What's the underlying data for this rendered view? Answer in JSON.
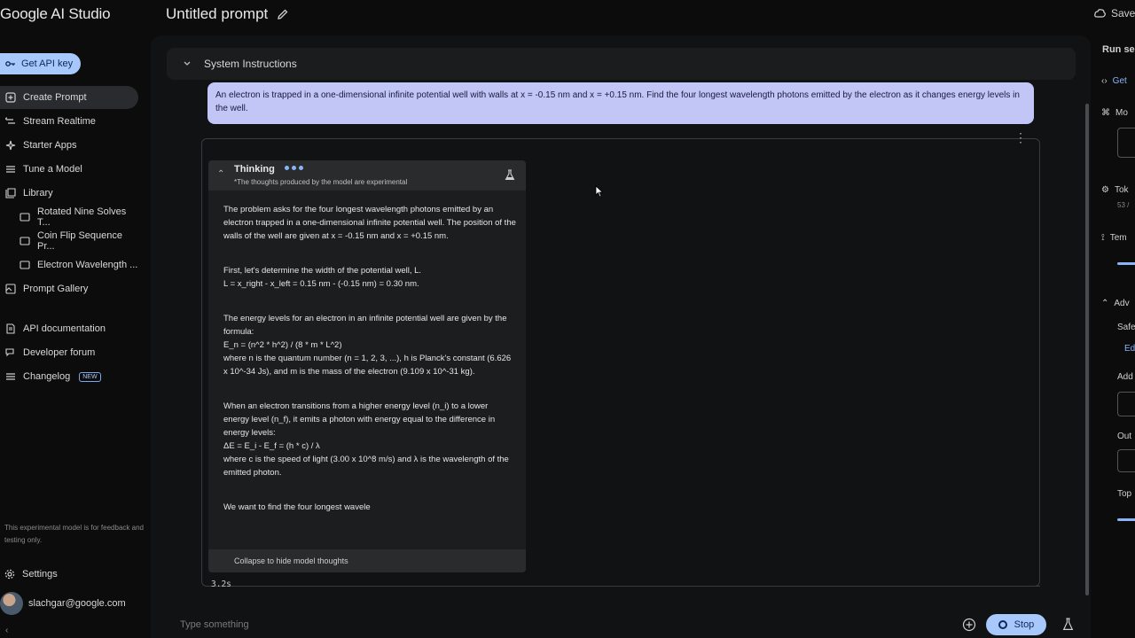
{
  "app": {
    "title": "Google AI Studio"
  },
  "header": {
    "prompt_title": "Untitled prompt",
    "save_label": "Save"
  },
  "sidebar": {
    "api_key_label": "Get API key",
    "items": [
      {
        "label": "Create Prompt",
        "icon": "plus-square-icon"
      },
      {
        "label": "Stream Realtime",
        "icon": "stream-icon"
      },
      {
        "label": "Starter Apps",
        "icon": "sparkle-icon"
      },
      {
        "label": "Tune a Model",
        "icon": "tune-icon"
      },
      {
        "label": "Library",
        "icon": "library-icon"
      },
      {
        "label": "Rotated Nine Solves T...",
        "icon": "chat-icon"
      },
      {
        "label": "Coin Flip Sequence Pr...",
        "icon": "chat-icon"
      },
      {
        "label": "Electron Wavelength ...",
        "icon": "chat-icon"
      },
      {
        "label": "Prompt Gallery",
        "icon": "gallery-icon"
      },
      {
        "label": "API documentation",
        "icon": "doc-icon"
      },
      {
        "label": "Developer forum",
        "icon": "forum-icon"
      },
      {
        "label": "Changelog",
        "icon": "changelog-icon",
        "badge": "NEW"
      }
    ],
    "footnote": "This experimental model is for feedback and testing only.",
    "settings_label": "Settings",
    "user_email": "slachgar@google.com"
  },
  "main": {
    "system_instructions_label": "System Instructions",
    "user_message": "An electron is trapped in a one-dimensional infinite potential well with walls at x = -0.15 nm and x = +0.15 nm. Find the four longest wavelength photons emitted by the electron as it changes energy levels in the well.",
    "thinking": {
      "title": "Thinking",
      "subtitle": "*The thoughts produced by the model are experimental",
      "paragraphs": [
        "The problem asks for the four longest wavelength photons emitted by an electron trapped in a one-dimensional infinite potential well. The position of the walls of the well are given at x = -0.15 nm and x = +0.15 nm.",
        "First, let's determine the width of the potential well, L.\nL = x_right - x_left = 0.15 nm - (-0.15 nm) = 0.30 nm.",
        "The energy levels for an electron in an infinite potential well are given by the formula:\nE_n = (n^2 * h^2) / (8 * m * L^2)\nwhere n is the quantum number (n = 1, 2, 3, ...), h is Planck's constant (6.626 x 10^-34 Js), and m is the mass of the electron (9.109 x 10^-31 kg).",
        "When an electron transitions from a higher energy level (n_i) to a lower energy level (n_f), it emits a photon with energy equal to the difference in energy levels:\nΔE = E_i - E_f = (h * c) / λ\nwhere c is the speed of light (3.00 x 10^8 m/s) and λ is the wavelength of the emitted photon.",
        "We want to find the four longest wavele"
      ],
      "collapse_label": "Collapse to hide model thoughts"
    },
    "elapsed": "3.2s"
  },
  "input": {
    "placeholder": "Type something",
    "stop_label": "Stop"
  },
  "right_panel": {
    "title": "Run se",
    "get_code": "Get",
    "model": "Mo",
    "tokens": "Tok",
    "tokens_value": "53 /",
    "temperature": "Tem",
    "advanced": "Adv",
    "safety": "Safe",
    "edit": "Ed",
    "add": "Add",
    "output": "Out",
    "top": "Top"
  },
  "colors": {
    "accent": "#a8c7fa",
    "user_bubble": "#c2c6f7",
    "background": "#0c0c0d"
  }
}
